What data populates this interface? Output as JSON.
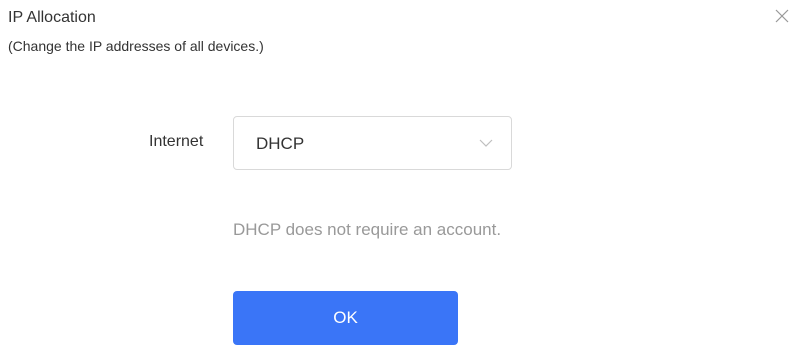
{
  "dialog": {
    "title": "IP Allocation",
    "subtitle": "(Change the IP addresses of all devices.)",
    "close_icon": "close-icon"
  },
  "internet": {
    "label": "Internet",
    "selected_value": "DHCP",
    "dropdown_icon": "chevron-down-icon"
  },
  "hint": "DHCP does not require an account.",
  "ok_button": {
    "label": "OK"
  },
  "colors": {
    "primary_button": "#3a75f7",
    "hint_text": "#999999",
    "border": "#d9d9d9"
  }
}
